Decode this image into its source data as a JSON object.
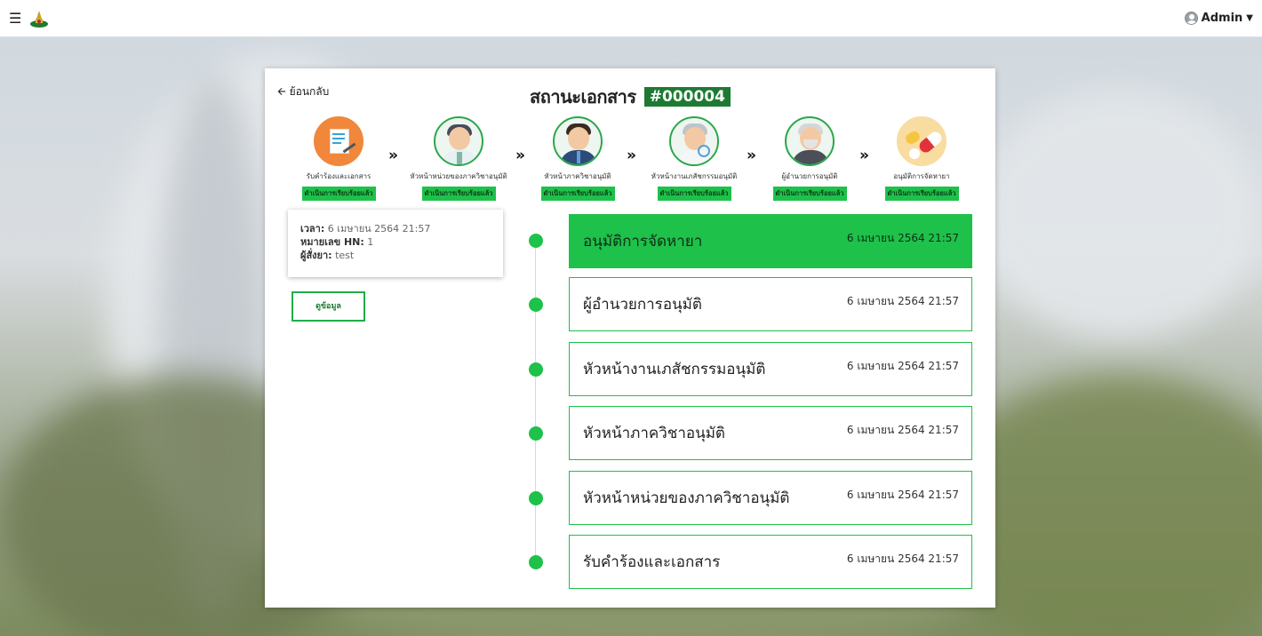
{
  "nav": {
    "user_label": "Admin"
  },
  "page": {
    "back_label": "ย้อนกลับ",
    "title": "สถานะเอกสาร",
    "doc_id": "#000004"
  },
  "steps": [
    {
      "label": "รับคำร้องและเอกสาร",
      "status": "ดำเนินการเรียบร้อยแล้ว"
    },
    {
      "label": "หัวหน้าหน่วยของภาควิชาอนุมัติ",
      "status": "ดำเนินการเรียบร้อยแล้ว"
    },
    {
      "label": "หัวหน้าภาควิชาอนุมัติ",
      "status": "ดำเนินการเรียบร้อยแล้ว"
    },
    {
      "label": "หัวหน้างานเภสัชกรรมอนุมัติ",
      "status": "ดำเนินการเรียบร้อยแล้ว"
    },
    {
      "label": "ผู้อำนวยการอนุมัติ",
      "status": "ดำเนินการเรียบร้อยแล้ว"
    },
    {
      "label": "อนุมัติการจัดหายา",
      "status": "ดำเนินการเรียบร้อยแล้ว"
    }
  ],
  "step_separator": "»",
  "info": {
    "time_label": "เวลา:",
    "time_value": "6 เมษายน 2564 21:57",
    "hn_label": "หมายเลข HN:",
    "hn_value": "1",
    "orderer_label": "ผู้สั่งยา:",
    "orderer_value": "test"
  },
  "view_button_label": "ดูข้อมูล",
  "timeline": [
    {
      "title": "อนุมัติการจัดหายา",
      "time": "6 เมษายน 2564 21:57"
    },
    {
      "title": "ผู้อำนวยการอนุมัติ",
      "time": "6 เมษายน 2564 21:57"
    },
    {
      "title": "หัวหน้างานเภสัชกรรมอนุมัติ",
      "time": "6 เมษายน 2564 21:57"
    },
    {
      "title": "หัวหน้าภาควิชาอนุมัติ",
      "time": "6 เมษายน 2564 21:57"
    },
    {
      "title": "หัวหน้าหน่วยของภาควิชาอนุมัติ",
      "time": "6 เมษายน 2564 21:57"
    },
    {
      "title": "รับคำร้องและเอกสาร",
      "time": "6 เมษายน 2564 21:57"
    }
  ],
  "colors": {
    "accent": "#1ec14a",
    "doc_id_bg": "#1d7a32",
    "border": "#1fae47"
  },
  "icons": {
    "menu": "hamburger-icon",
    "back": "arrow-left-icon",
    "user": "user-circle-icon"
  }
}
